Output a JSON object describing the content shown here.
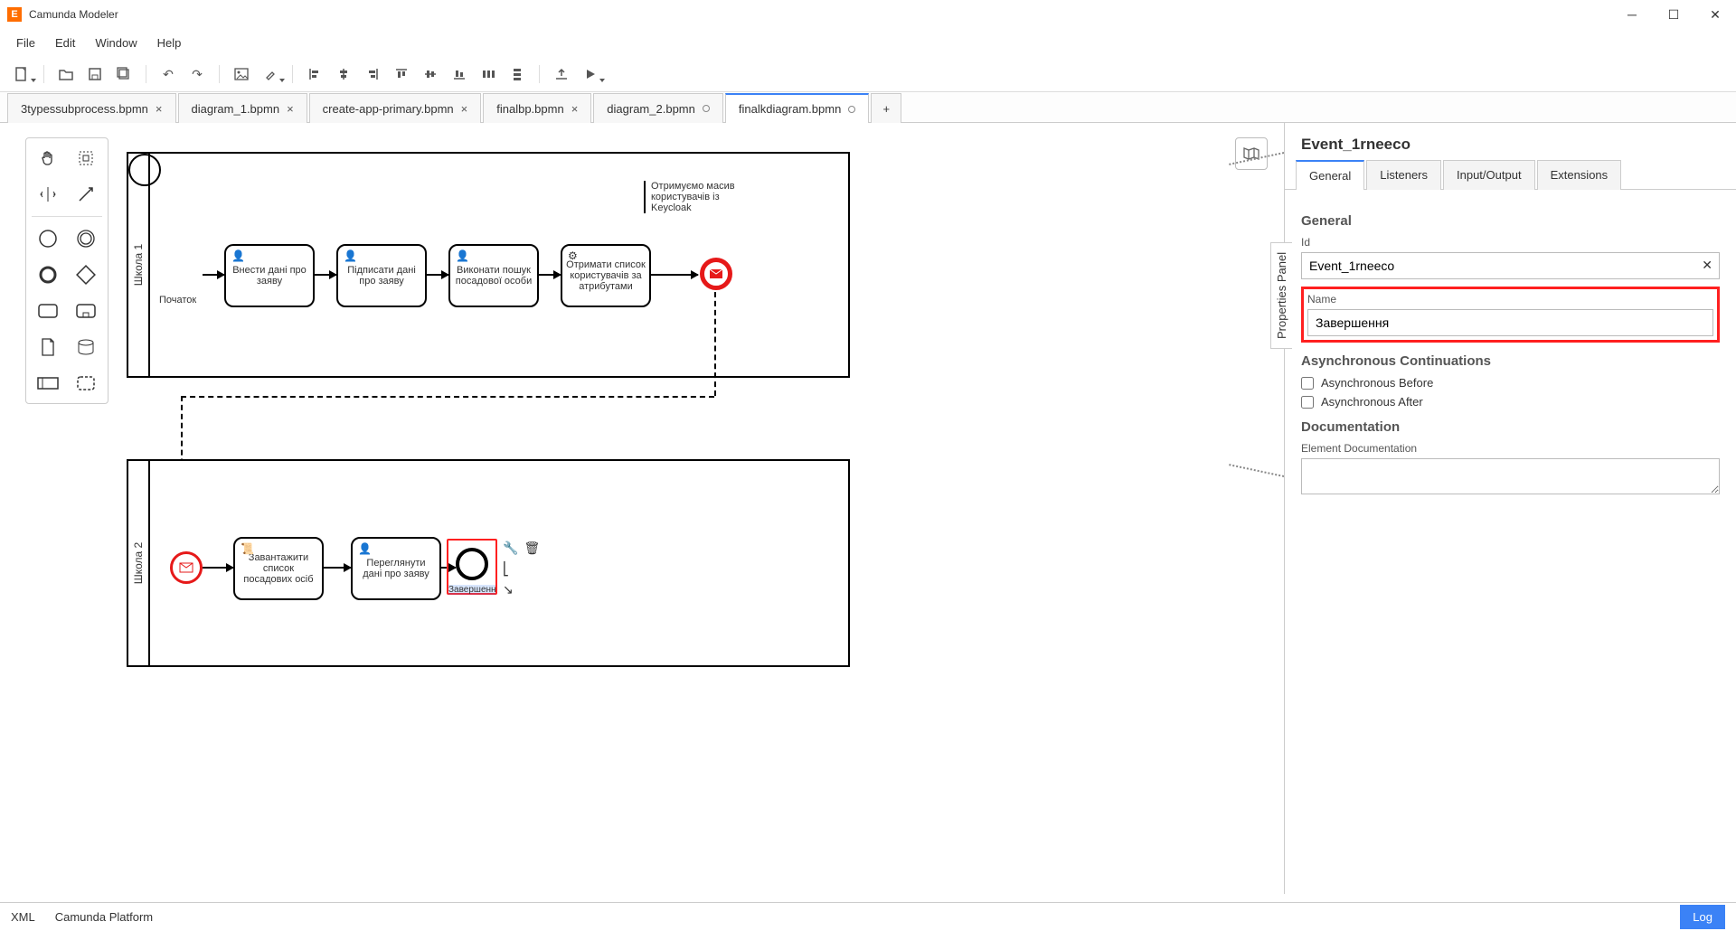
{
  "window": {
    "title": "Camunda Modeler"
  },
  "menu": {
    "file": "File",
    "edit": "Edit",
    "window": "Window",
    "help": "Help"
  },
  "tabs": {
    "items": [
      {
        "label": "3typessubprocess.bpmn",
        "dirty": false
      },
      {
        "label": "diagram_1.bpmn",
        "dirty": false
      },
      {
        "label": "create-app-primary.bpmn",
        "dirty": false
      },
      {
        "label": "finalbp.bpmn",
        "dirty": false
      },
      {
        "label": "diagram_2.bpmn",
        "dirty": true
      },
      {
        "label": "finalkdiagram.bpmn",
        "dirty": true,
        "active": true
      }
    ],
    "plus": "+"
  },
  "diagram": {
    "pool1": {
      "name": "Школа 1",
      "start_label": "Початок",
      "task1": "Внести дані про заяву",
      "task2": "Підписати дані про заяву",
      "task3": "Виконати пошук посадової особи",
      "task4": "Отримати список користувачів за атрибутами",
      "annotation": "Отримуємо масив користувачів із Keycloak"
    },
    "pool2": {
      "name": "Школа 2",
      "task1": "Завантажити список посадових осіб",
      "task2": "Переглянути дані про заяву",
      "end_label": "Завершенн"
    }
  },
  "properties": {
    "panel_label": "Properties Panel",
    "header": "Event_1rneeco",
    "tabs": {
      "general": "General",
      "listeners": "Listeners",
      "io": "Input/Output",
      "ext": "Extensions"
    },
    "general_section": "General",
    "id_label": "Id",
    "id_value": "Event_1rneeco",
    "name_label": "Name",
    "name_value": "Завершення",
    "async_section": "Asynchronous Continuations",
    "async_before": "Asynchronous Before",
    "async_after": "Asynchronous After",
    "doc_section": "Documentation",
    "doc_label": "Element Documentation"
  },
  "status": {
    "xml": "XML",
    "platform": "Camunda Platform",
    "log": "Log"
  }
}
